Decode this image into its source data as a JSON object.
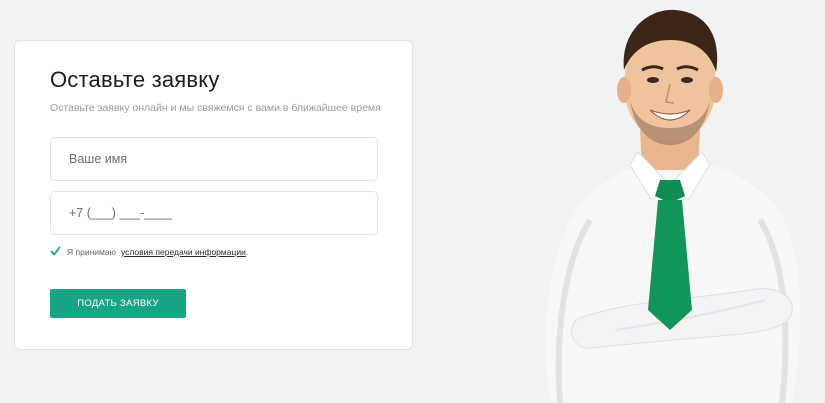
{
  "form": {
    "title": "Оставьте заявку",
    "subtitle": "Оставьте заявку онлайн и мы свяжемся с вами в ближайшее время",
    "name_placeholder": "Ваше имя",
    "phone_placeholder": "+7 (___) ___-____",
    "agree_text": "Я принимаю",
    "agree_link": "условия передачи информации",
    "agree_suffix": ".",
    "agree_checked": true,
    "submit_label": "ПОДАТЬ ЗАЯВКУ"
  },
  "image": {
    "description_icon": "man-portrait"
  },
  "colors": {
    "accent": "#18a586",
    "background": "#f1f2f1",
    "tie": "#0f8d55"
  }
}
